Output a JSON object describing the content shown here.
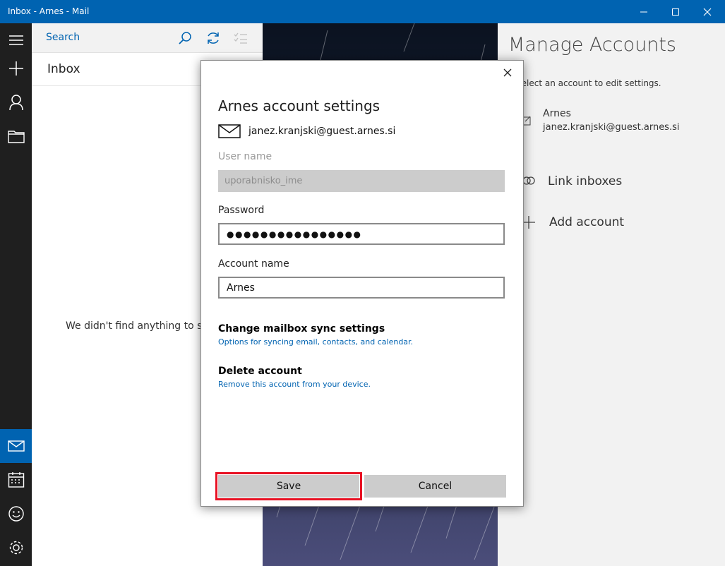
{
  "window": {
    "title": "Inbox - Arnes - Mail"
  },
  "search": {
    "label": "Search"
  },
  "inbox": {
    "header": "Inbox",
    "empty_message": "We didn't find anything to show here."
  },
  "manage_accounts": {
    "title": "Manage Accounts",
    "subtitle": "Select an account to edit settings.",
    "account": {
      "name": "Arnes",
      "email": "janez.kranjski@guest.arnes.si"
    },
    "link_inboxes": "Link inboxes",
    "add_account": "Add account"
  },
  "dialog": {
    "title": "Arnes account settings",
    "email": "janez.kranjski@guest.arnes.si",
    "username_label": "User name",
    "username_value": "uporabnisko_ime",
    "password_label": "Password",
    "password_value": "●●●●●●●●●●●●●●●●",
    "account_name_label": "Account name",
    "account_name_value": "Arnes",
    "sync_title": "Change mailbox sync settings",
    "sync_subtitle": "Options for syncing email, contacts, and calendar.",
    "delete_title": "Delete account",
    "delete_subtitle": "Remove this account from your device.",
    "save_label": "Save",
    "cancel_label": "Cancel"
  },
  "colors": {
    "accent": "#0063b1",
    "highlight": "#e81123",
    "rail": "#1f1f1f"
  }
}
